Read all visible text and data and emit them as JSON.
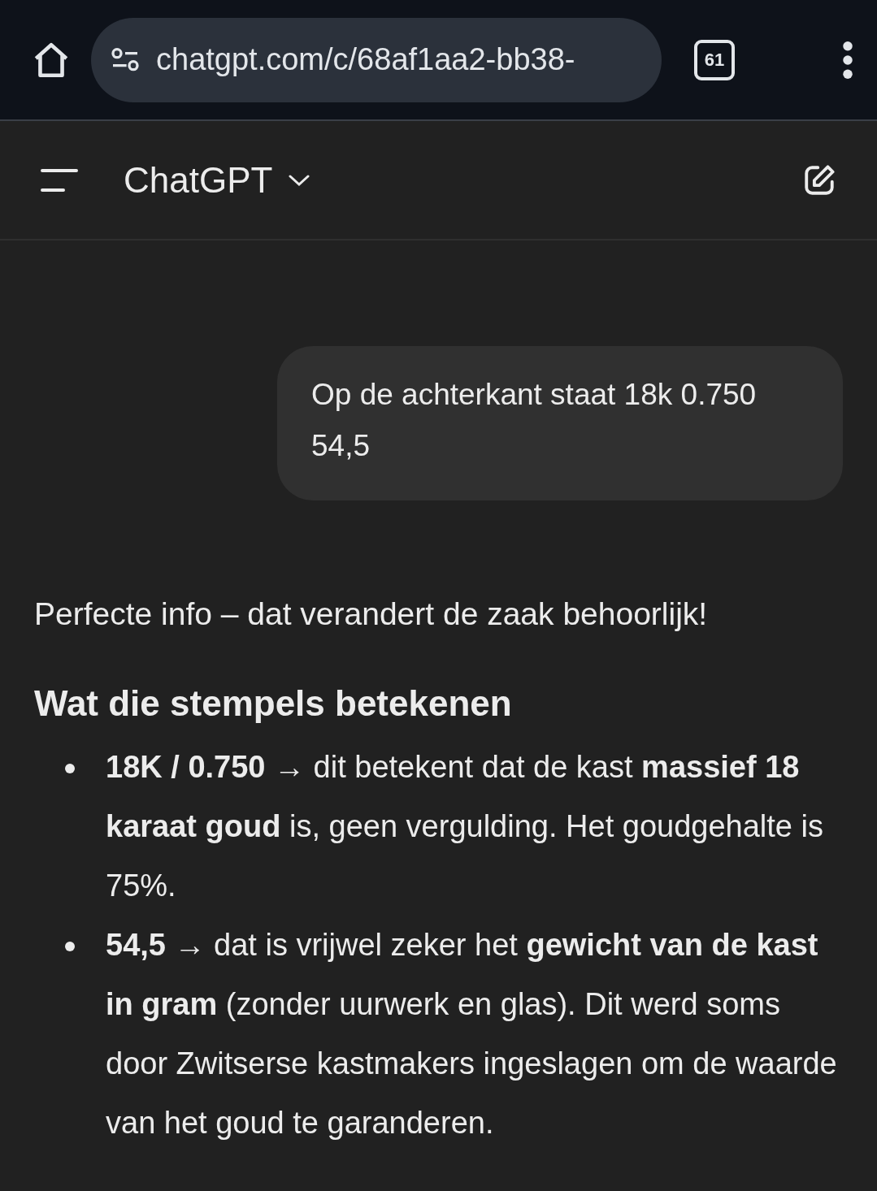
{
  "browser": {
    "url": "chatgpt.com/c/68af1aa2-bb38-",
    "tab_count": "61"
  },
  "header": {
    "title": "ChatGPT"
  },
  "messages": [
    {
      "kind": "user",
      "text": "Op de achterkant staat 18k 0.750 54,5"
    },
    {
      "kind": "assistant",
      "blocks": [
        {
          "kind": "paragraph",
          "text": "Perfecte info – dat verandert de zaak behoorlijk!"
        },
        {
          "kind": "heading",
          "text": "Wat die stempels betekenen"
        },
        {
          "kind": "bullets",
          "items": [
            "**18K / 0.750** → dit betekent dat de kast **massief 18 karaat goud** is, geen vergulding. Het goudgehalte is 75%.",
            "**54,5** → dat is vrijwel zeker het **gewicht van de kast in gram** (zonder uurwerk en glas). Dit werd soms door Zwitserse kastmakers ingeslagen om de waarde van het goud te garanderen."
          ]
        }
      ]
    }
  ]
}
